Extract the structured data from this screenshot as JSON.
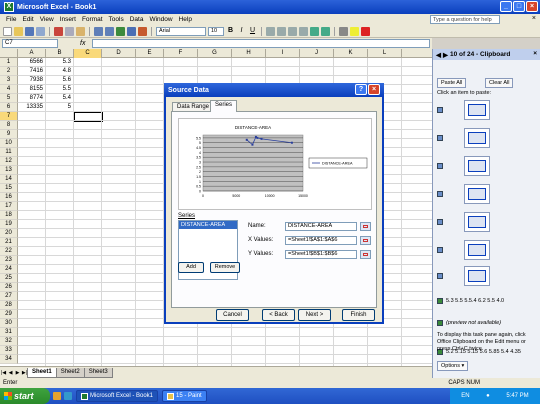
{
  "window": {
    "title": "Microsoft Excel - Book1"
  },
  "menu": [
    "File",
    "Edit",
    "View",
    "Insert",
    "Format",
    "Tools",
    "Data",
    "Window",
    "Help"
  ],
  "help_placeholder": "Type a question for help",
  "toolbar": {
    "font": "Arial",
    "size": "10"
  },
  "formula": {
    "cell_ref": "C7",
    "fx": "fx",
    "content": ""
  },
  "grid": {
    "columns": [
      "A",
      "B",
      "C",
      "D",
      "E",
      "F",
      "G",
      "H",
      "I",
      "J",
      "K",
      "L"
    ],
    "rows": [
      "1",
      "2",
      "3",
      "4",
      "5",
      "6",
      "7",
      "8",
      "9",
      "10",
      "11",
      "12",
      "13",
      "14",
      "15",
      "16",
      "17",
      "18",
      "19",
      "20",
      "21",
      "22",
      "23",
      "24",
      "25",
      "26",
      "27",
      "28",
      "29",
      "30",
      "31",
      "32",
      "33",
      "34"
    ],
    "col_a": [
      "6566",
      "7416",
      "7938",
      "8155",
      "8774",
      "13335"
    ],
    "col_b": [
      "5.3",
      "4.8",
      "5.6",
      "5.5",
      "5.4",
      "5"
    ],
    "selected_cell": "C7"
  },
  "sheets": [
    "Sheet1",
    "Sheet2",
    "Sheet3"
  ],
  "status": {
    "left": "Enter",
    "right": "CAPS NUM"
  },
  "taskbar": {
    "start": "start",
    "tasks": [
      "Microsoft Excel - Book1",
      "15 - Paint"
    ],
    "lang": "EN",
    "time": "5:47 PM"
  },
  "pane": {
    "title": "10 of 24 - Clipboard",
    "paste_all": "Paste All",
    "clear_all": "Clear All",
    "click_item": "Click an item to paste:",
    "text_items": [
      "5.3 5.5 5.5.4 6.2 5.5 4.0",
      "(preview not available)",
      "5.2 5.15 5.15 5.6 5.85 5.4 4.35"
    ],
    "help_text": "To display this task pane again, click Office Clipboard on the Edit menu or press Ctrl+C twice.",
    "options": "Options ▾"
  },
  "dialog": {
    "title": "Source Data",
    "tabs": [
      "Data Range",
      "Series"
    ],
    "series_label": "Series",
    "series_items": [
      "DISTANCE-AREA"
    ],
    "add": "Add",
    "remove": "Remove",
    "name_label": "Name:",
    "name_value": "DISTANCE-AREA",
    "x_label": "X Values:",
    "x_value": "=Sheet1!$A$1:$A$6",
    "y_label": "Y Values:",
    "y_value": "=Sheet1!$B$1:$B$6",
    "buttons": [
      "Cancel",
      "< Back",
      "Next >",
      "Finish"
    ]
  },
  "chart_data": {
    "type": "line",
    "title": "DISTANCE-AREA",
    "series": [
      {
        "name": "DISTANCE-AREA",
        "x": [
          6566,
          7416,
          7938,
          8155,
          8774,
          13335
        ],
        "y": [
          5.3,
          4.8,
          5.6,
          5.5,
          5.4,
          5
        ]
      }
    ],
    "xlim": [
      0,
      15000
    ],
    "ylim": [
      0,
      5.8
    ],
    "xticks": [
      "0",
      "5000",
      "10000",
      "15000"
    ],
    "yticks": [
      "0",
      "0.5",
      "1",
      "1.5",
      "2",
      "2.5",
      "3",
      "3.5",
      "4",
      "4.5",
      "5",
      "5.5"
    ],
    "legend": "right",
    "line_color": "#2a3f9c"
  }
}
